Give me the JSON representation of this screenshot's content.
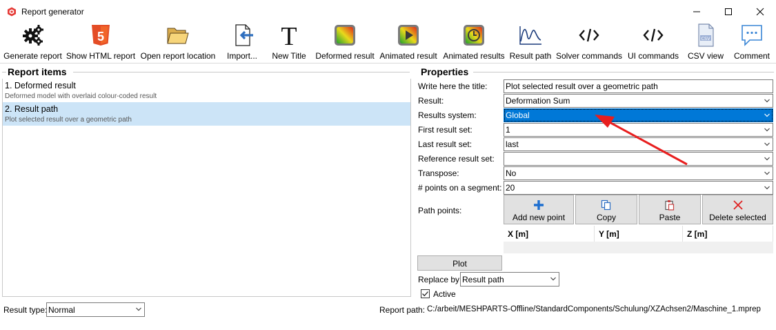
{
  "window": {
    "title": "Report generator"
  },
  "toolbar": {
    "buttons": [
      {
        "label": "Generate report",
        "icon": "gears-icon"
      },
      {
        "label": "Show HTML report",
        "icon": "html5-icon"
      },
      {
        "label": "Open report location",
        "icon": "folder-icon"
      },
      {
        "label": "Import...",
        "icon": "import-icon"
      },
      {
        "label": "New Title",
        "icon": "title-t-icon"
      },
      {
        "label": "Deformed result",
        "icon": "deformed-result-icon"
      },
      {
        "label": "Animated result",
        "icon": "animated-result-icon"
      },
      {
        "label": "Animated results",
        "icon": "animated-results-icon"
      },
      {
        "label": "Result path",
        "icon": "result-path-icon"
      },
      {
        "label": "Solver commands",
        "icon": "code-icon"
      },
      {
        "label": "UI commands",
        "icon": "code-icon"
      },
      {
        "label": "CSV view",
        "icon": "csv-file-icon"
      },
      {
        "label": "Comment",
        "icon": "comment-icon"
      }
    ]
  },
  "report_items": {
    "header": "Report items",
    "items": [
      {
        "title": "1. Deformed result",
        "subtitle": "Deformed model with overlaid colour-coded result",
        "selected": false
      },
      {
        "title": "2. Result path",
        "subtitle": "Plot selected result over a geometric path",
        "selected": true
      }
    ]
  },
  "properties": {
    "header": "Properties",
    "rows": [
      {
        "label": "Write here the title:",
        "value": "Plot selected result over a geometric path",
        "dropdown": false
      },
      {
        "label": "Result:",
        "value": "Deformation Sum",
        "dropdown": true
      },
      {
        "label": "Results system:",
        "value": "Global",
        "dropdown": true
      },
      {
        "label": "First result set:",
        "value": "1",
        "dropdown": true
      },
      {
        "label": "Last result set:",
        "value": "last",
        "dropdown": true
      },
      {
        "label": "Reference result set:",
        "value": "",
        "dropdown": true
      },
      {
        "label": "Transpose:",
        "value": "No",
        "dropdown": true
      },
      {
        "label": "# points on a segment:",
        "value": "20",
        "dropdown": true
      }
    ],
    "path_points_label": "Path points:",
    "path_buttons": {
      "add": "Add new point",
      "copy": "Copy",
      "paste": "Paste",
      "delete": "Delete selected"
    },
    "columns": [
      "X [m]",
      "Y [m]",
      "Z [m]"
    ],
    "plot_label": "Plot",
    "replace_by_label": "Replace by:",
    "replace_by_value": "Result path",
    "active_label": "Active",
    "active_checked": true
  },
  "status": {
    "result_type_label": "Result type:",
    "result_type_value": "Normal",
    "report_path_label": "Report path:",
    "report_path_value": "C:/arbeit/MESHPARTS-Offline/StandardComponents/Schulung/XZAchsen2/Maschine_1.mprep"
  },
  "colors": {
    "accent": "#0078d7",
    "selected_row": "#cce4f7",
    "annotation_arrow": "#e81e1e"
  }
}
